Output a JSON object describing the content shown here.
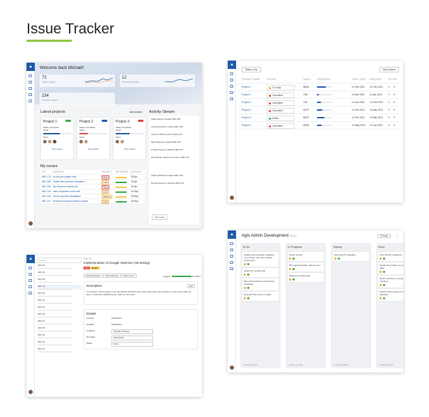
{
  "page": {
    "title": "Issue Tracker"
  },
  "dashboard": {
    "welcome": "Welcome back Michael!",
    "stats": [
      {
        "value": "73",
        "label": "Total Tasks"
      },
      {
        "value": "12",
        "label": "Pending tasks"
      },
      {
        "value": "234",
        "label": "Closed tasks"
      }
    ],
    "latest_projects": "Latest projects",
    "add_project": "Add project",
    "projects": [
      {
        "name": "Project 1",
        "completed": "Tasks completed",
        "count": "31/46",
        "team": "Team",
        "view": "View project",
        "progress": 0.6
      },
      {
        "name": "Project 2",
        "completed": "Tasks completed",
        "count": "18/23",
        "team": "Team",
        "view": "View project",
        "progress": 0.3
      },
      {
        "name": "Project 3",
        "completed": "Tasks completed",
        "count": "22/42",
        "team": "Team",
        "view": "View project",
        "progress": 0.5
      }
    ],
    "activity_title": "Activity Stream",
    "my_issues": "My issues",
    "issue_cols": [
      "KEY",
      "SUMMARY",
      "PRIORITY",
      "PROGRESS",
      "DUE DATE"
    ],
    "issues": [
      {
        "key": "ABC-175",
        "summary": "Id velit quo magnis sapi",
        "priority": "High",
        "due": "28 Apr"
      },
      {
        "key": "ABC-166",
        "summary": "Facilis mieo proiente voluptatem",
        "priority": "Low",
        "due": "29 Apr"
      },
      {
        "key": "ABC-153",
        "summary": "Qui tempore voluptas est",
        "priority": "High",
        "due": "30 Apr"
      },
      {
        "key": "ABC-146",
        "summary": "Iusto voluptatem nemo sunt",
        "priority": "Low",
        "due": "01 May"
      },
      {
        "key": "ABC-138",
        "summary": "Omnis eiusmod voluptatibus",
        "priority": "Medium",
        "due": "03 May"
      },
      {
        "key": "ABC-127",
        "summary": "Provident ad ipsam eveniet cumque",
        "priority": "Low",
        "due": "05 May"
      }
    ],
    "activity_items": [
      "Wade Warren created ABC-198",
      "Leslie Alexander created ABC-183",
      "Theresa Webb resolved ABC-165",
      "Max Robinson created ABC-191",
      "Freddie Nguyen updated ABC-172",
      "Eliza Rohan attached one file to ABC-167",
      "Shawn Richards created ABC-189",
      "Ronnie Sanchez resolved ABC-149"
    ],
    "view_more": "View more"
  },
  "projects_table": {
    "status_filter": "Status: Any",
    "new_project": "New project",
    "columns": [
      "PROJECT NAME",
      "STATUS",
      "TASKS",
      "PROGRESS",
      "START DATE",
      "END DATE",
      "ACTION"
    ],
    "rows": [
      {
        "name": "Project 1",
        "status": "On Hold",
        "tasks": "38/45",
        "progress": 0.6,
        "start": "11 Feb 2021",
        "end": "11 Feb 2021"
      },
      {
        "name": "Project 2",
        "status": "Cancelled",
        "tasks": "7/56",
        "progress": 0.15,
        "start": "11 Mar 2021",
        "end": "11 Apr 2021"
      },
      {
        "name": "Project 3",
        "status": "Cancelled",
        "tasks": "7/31",
        "progress": 0.25,
        "start": "14 Jan 2021",
        "end": "14 Feb 2021"
      },
      {
        "name": "Project 4",
        "status": "Cancelled",
        "tasks": "26/79",
        "progress": 0.35,
        "start": "10 Feb 2021",
        "end": "16 Mar 2021"
      },
      {
        "name": "Project 5",
        "status": "Active",
        "tasks": "38/75",
        "progress": 0.5,
        "start": "11 Feb 2021",
        "end": "15 Mar 2021"
      },
      {
        "name": "Project 6",
        "status": "Cancelled",
        "tasks": "28/99",
        "progress": 0.3,
        "start": "10 May 2021",
        "end": "23 Jun 2021"
      }
    ],
    "status_colors": {
      "On Hold": "#f0a028",
      "Cancelled": "#e0453a",
      "Active": "#3aa648"
    }
  },
  "issue_detail": {
    "search": "Search",
    "key": "PRI-75",
    "name": "Implementation of Google Optimize (AB testing)",
    "badges": [
      "Bug",
      "Bugfix"
    ],
    "buttons": [
      "Start Resolution",
      "Show all Items",
      "Show more"
    ],
    "logged_label": "Logged",
    "logged_value": "2h 15min",
    "description_title": "Description",
    "edit": "Edit",
    "description": "Consectetur. Omnis eaque enim qui placeat doloribus velit omnis optio quae reprehenderit. Lorem ipsum dolor sit amet, consectetur adipisicing elit. Autem et hic quasi.",
    "details_title": "Details",
    "details": [
      {
        "label": "Created",
        "value": "16/03/2021"
      },
      {
        "label": "Updated",
        "value": "16/03/2021"
      },
      {
        "label": "Assignee",
        "value": "Meghan Aldridge"
      },
      {
        "label": "Due Date",
        "value": "26/04/2021"
      },
      {
        "label": "Status",
        "value": "Done"
      }
    ],
    "list": [
      "ABC-82",
      "ABC-83",
      "ABC-85",
      "ABC-79",
      "ABC-80",
      "ABC-81",
      "ABC-84",
      "ABC-86",
      "ABC-87",
      "ABC-88",
      "ABC-89",
      "ABC-90",
      "ABC-91"
    ]
  },
  "board": {
    "title": "Aglo Admin Development",
    "version": "v5.0.0",
    "private": "Private",
    "columns": [
      {
        "name": "To Do",
        "cards": [
          "Update documentation regarding “Let's Invite” and “Let's Update” components",
          "Support for sociial login",
          "Microsoft OneDrive & Sharepoint integration",
          "Drag and drop issues in Edge"
        ]
      },
      {
        "name": "In Progress",
        "cards": [
          "Report section",
          "RTL support (Arabic, Hebrew etc.)",
          "Support for social login"
        ]
      },
      {
        "name": "Testing",
        "cards": [
          "External API integration"
        ]
      },
      {
        "name": "Done",
        "cards": [
          "Personal API integration",
          "Social share button on notification page",
          "Restrict access to a project to its members",
          "Synchronizing issues to a new Helpdesk"
        ]
      }
    ],
    "add_task": "+ Add new task"
  }
}
